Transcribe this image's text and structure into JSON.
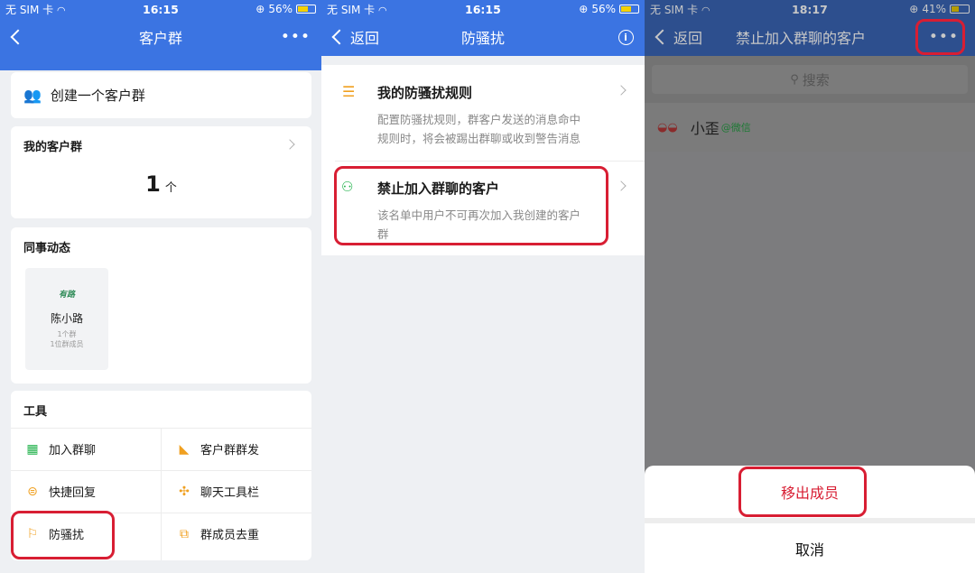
{
  "panel1": {
    "status": {
      "carrier": "无 SIM 卡",
      "time": "16:15",
      "battery": "56%"
    },
    "title": "客户群",
    "more": "•••",
    "create_label": "创建一个客户群",
    "my_groups": {
      "title": "我的客户群",
      "count": "1",
      "unit": "个"
    },
    "colleague": {
      "title": "同事动态",
      "person": {
        "avatar_text": "有路",
        "name": "陈小路",
        "groups": "1个群",
        "members": "1位群成员"
      }
    },
    "tools": {
      "title": "工具",
      "items": [
        {
          "label": "加入群聊",
          "icon": "qr-code-icon"
        },
        {
          "label": "客户群群发",
          "icon": "broadcast-icon"
        },
        {
          "label": "快捷回复",
          "icon": "quick-reply-icon"
        },
        {
          "label": "聊天工具栏",
          "icon": "toolbar-icon"
        },
        {
          "label": "防骚扰",
          "icon": "flag-icon"
        },
        {
          "label": "群成员去重",
          "icon": "dedupe-icon"
        }
      ]
    }
  },
  "panel2": {
    "status": {
      "carrier": "无 SIM 卡",
      "time": "16:15",
      "battery": "56%"
    },
    "back": "返回",
    "title": "防骚扰",
    "info": "i",
    "rules": {
      "title": "我的防骚扰规则",
      "desc_line1": "配置防骚扰规则，群客户发送的消息命中",
      "desc_line2": "规则时，将会被踢出群聊或收到警告消息"
    },
    "blocked": {
      "title": "禁止加入群聊的客户",
      "desc_line1": "该名单中用户不可再次加入我创建的客户",
      "desc_line2": "群"
    }
  },
  "panel3": {
    "status": {
      "carrier": "无 SIM 卡",
      "time": "18:17",
      "battery": "41%"
    },
    "back": "返回",
    "title": "禁止加入群聊的客户",
    "more": "•••",
    "search_placeholder": "搜索",
    "member": {
      "name": "小歪",
      "tag": "@微信"
    },
    "sheet": {
      "remove": "移出成员",
      "cancel": "取消"
    }
  },
  "colors": {
    "nav_blue": "#3b74e2",
    "highlight_red": "#d81e33",
    "wechat_green": "#21b24b",
    "orange": "#f0a020"
  }
}
